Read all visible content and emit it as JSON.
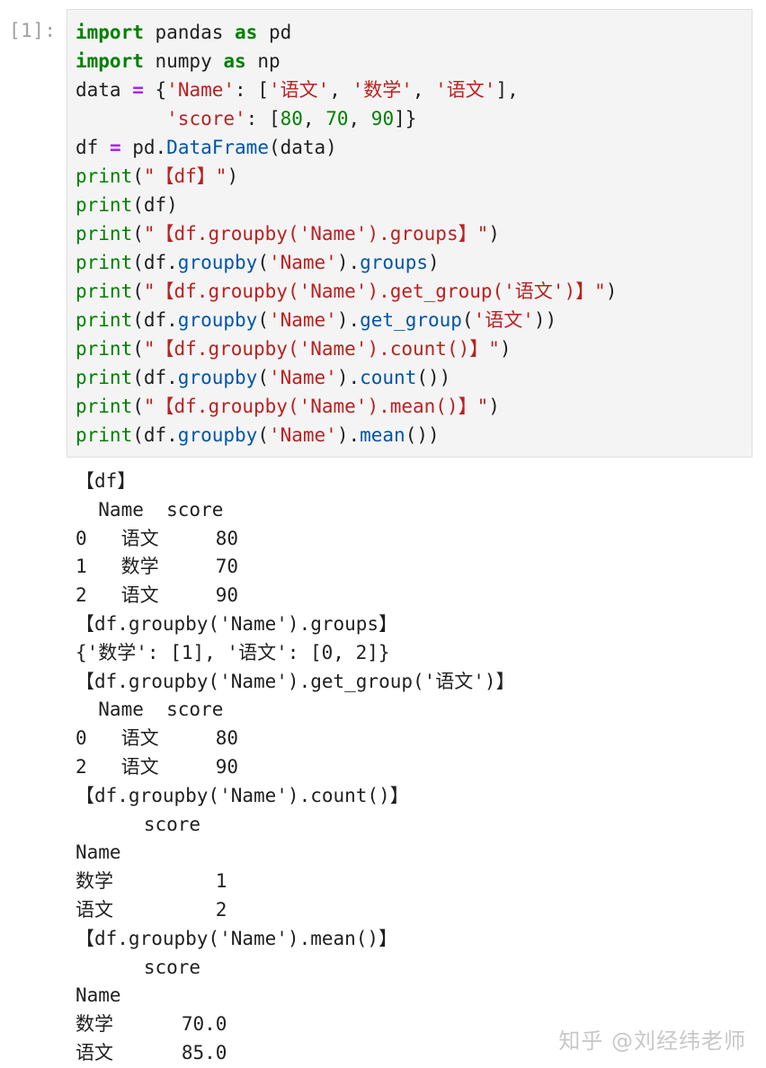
{
  "cell": {
    "prompt": "[1]:",
    "code_lines": [
      [
        {
          "t": "import",
          "c": "kw"
        },
        {
          "t": " pandas "
        },
        {
          "t": "as",
          "c": "kw"
        },
        {
          "t": " pd"
        }
      ],
      [
        {
          "t": "import",
          "c": "kw"
        },
        {
          "t": " numpy "
        },
        {
          "t": "as",
          "c": "kw"
        },
        {
          "t": " np"
        }
      ],
      [
        {
          "t": "data "
        },
        {
          "t": "=",
          "c": "op"
        },
        {
          "t": " {"
        },
        {
          "t": "'Name'",
          "c": "str"
        },
        {
          "t": ": ["
        },
        {
          "t": "'语文'",
          "c": "str"
        },
        {
          "t": ", "
        },
        {
          "t": "'数学'",
          "c": "str"
        },
        {
          "t": ", "
        },
        {
          "t": "'语文'",
          "c": "str"
        },
        {
          "t": "],"
        }
      ],
      [
        {
          "t": "        "
        },
        {
          "t": "'score'",
          "c": "str"
        },
        {
          "t": ": ["
        },
        {
          "t": "80",
          "c": "num"
        },
        {
          "t": ", "
        },
        {
          "t": "70",
          "c": "num"
        },
        {
          "t": ", "
        },
        {
          "t": "90",
          "c": "num"
        },
        {
          "t": "]}"
        }
      ],
      [
        {
          "t": "df "
        },
        {
          "t": "=",
          "c": "op"
        },
        {
          "t": " pd."
        },
        {
          "t": "DataFrame",
          "c": "attr"
        },
        {
          "t": "(data)"
        }
      ],
      [
        {
          "t": "print",
          "c": "fn"
        },
        {
          "t": "("
        },
        {
          "t": "\"【df】\"",
          "c": "str"
        },
        {
          "t": ")"
        }
      ],
      [
        {
          "t": "print",
          "c": "fn"
        },
        {
          "t": "(df)"
        }
      ],
      [
        {
          "t": "print",
          "c": "fn"
        },
        {
          "t": "("
        },
        {
          "t": "\"【df.groupby('Name').groups】\"",
          "c": "str"
        },
        {
          "t": ")"
        }
      ],
      [
        {
          "t": "print",
          "c": "fn"
        },
        {
          "t": "(df."
        },
        {
          "t": "groupby",
          "c": "attr"
        },
        {
          "t": "("
        },
        {
          "t": "'Name'",
          "c": "str"
        },
        {
          "t": ")."
        },
        {
          "t": "groups",
          "c": "attr"
        },
        {
          "t": ")"
        }
      ],
      [
        {
          "t": "print",
          "c": "fn"
        },
        {
          "t": "("
        },
        {
          "t": "\"【df.groupby('Name').get_group('语文')】\"",
          "c": "str"
        },
        {
          "t": ")"
        }
      ],
      [
        {
          "t": "print",
          "c": "fn"
        },
        {
          "t": "(df."
        },
        {
          "t": "groupby",
          "c": "attr"
        },
        {
          "t": "("
        },
        {
          "t": "'Name'",
          "c": "str"
        },
        {
          "t": ")."
        },
        {
          "t": "get_group",
          "c": "attr"
        },
        {
          "t": "("
        },
        {
          "t": "'语文'",
          "c": "str"
        },
        {
          "t": "))"
        }
      ],
      [
        {
          "t": "print",
          "c": "fn"
        },
        {
          "t": "("
        },
        {
          "t": "\"【df.groupby('Name').count()】\"",
          "c": "str"
        },
        {
          "t": ")"
        }
      ],
      [
        {
          "t": "print",
          "c": "fn"
        },
        {
          "t": "(df."
        },
        {
          "t": "groupby",
          "c": "attr"
        },
        {
          "t": "("
        },
        {
          "t": "'Name'",
          "c": "str"
        },
        {
          "t": ")."
        },
        {
          "t": "count",
          "c": "attr"
        },
        {
          "t": "())"
        }
      ],
      [
        {
          "t": "print",
          "c": "fn"
        },
        {
          "t": "("
        },
        {
          "t": "\"【df.groupby('Name').mean()】\"",
          "c": "str"
        },
        {
          "t": ")"
        }
      ],
      [
        {
          "t": "print",
          "c": "fn"
        },
        {
          "t": "(df."
        },
        {
          "t": "groupby",
          "c": "attr"
        },
        {
          "t": "("
        },
        {
          "t": "'Name'",
          "c": "str"
        },
        {
          "t": ")."
        },
        {
          "t": "mean",
          "c": "attr"
        },
        {
          "t": "())"
        }
      ]
    ]
  },
  "output_lines": [
    "【df】",
    "  Name  score",
    "0   语文     80",
    "1   数学     70",
    "2   语文     90",
    "【df.groupby('Name').groups】",
    "{'数学': [1], '语文': [0, 2]}",
    "【df.groupby('Name').get_group('语文')】",
    "  Name  score",
    "0   语文     80",
    "2   语文     90",
    "【df.groupby('Name').count()】",
    "      score",
    "Name",
    "数学         1",
    "语文         2",
    "【df.groupby('Name').mean()】",
    "      score",
    "Name",
    "数学      70.0",
    "语文      85.0"
  ],
  "watermark": "知乎 @刘经纬老师",
  "colors": {
    "keyword": "#008000",
    "string": "#ba2121",
    "attribute": "#0055aa",
    "operator": "#aa22ff",
    "cell_background": "#f4f4f4",
    "prompt": "#a0a0a0"
  }
}
